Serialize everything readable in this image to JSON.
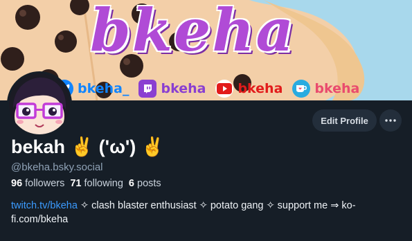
{
  "banner": {
    "brand": "bkeha",
    "socials": [
      {
        "label": "bkeha_",
        "icon": "bluesky-icon",
        "color": "#1185fe"
      },
      {
        "label": "bkeha",
        "icon": "twitch-icon",
        "color": "#8a3fd1"
      },
      {
        "label": "bkeha",
        "icon": "youtube-icon",
        "color": "#e21b1b"
      },
      {
        "label": "bkeha",
        "icon": "kofi-icon",
        "color": "#e94b6e"
      }
    ]
  },
  "profile": {
    "display_name": "bekah ✌️ ('ω') ✌️",
    "handle": "@bkeha.bsky.social",
    "edit_label": "Edit Profile",
    "more_icon": "ellipsis-icon",
    "stats": {
      "followers_count": "96",
      "followers_label": "followers",
      "following_count": "71",
      "following_label": "following",
      "posts_count": "6",
      "posts_label": "posts"
    },
    "bio": {
      "link_text": "twitch.tv/bkeha",
      "rest": " ✧ clash blaster enthusiast ✧ potato gang ✧ support me ⇒ ko-fi.com/bkeha"
    }
  },
  "colors": {
    "background": "#161e27",
    "accent_link": "#3b9bff",
    "banner_peach": "#f3cfa8",
    "banner_sky": "#a8d8ec",
    "script_purple": "#b04bd6"
  }
}
